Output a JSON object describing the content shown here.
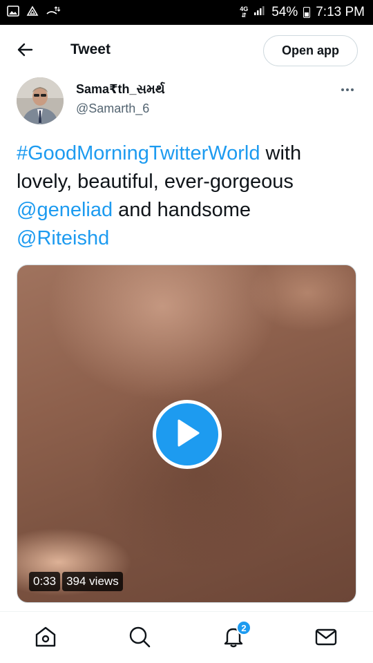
{
  "status_bar": {
    "network": "4G",
    "battery": "54%",
    "time": "7:13 PM"
  },
  "header": {
    "title": "Tweet",
    "open_app_label": "Open app"
  },
  "author": {
    "name": "Sama₹th_સમર્થ",
    "handle": "@Samarth_6"
  },
  "tweet": {
    "hashtag": "#GoodMorningTwitterWorld",
    "text_1": " with lovely, beautiful, ever-gorgeous ",
    "mention_1": "@geneliad",
    "text_2": " and handsome ",
    "mention_2": "@Riteishd"
  },
  "media": {
    "duration": "0:33",
    "views": "394 views"
  },
  "bottom_nav": {
    "notifications_count": "2"
  },
  "colors": {
    "accent": "#1d9bf0",
    "text": "#0f1419",
    "secondary": "#536471"
  }
}
